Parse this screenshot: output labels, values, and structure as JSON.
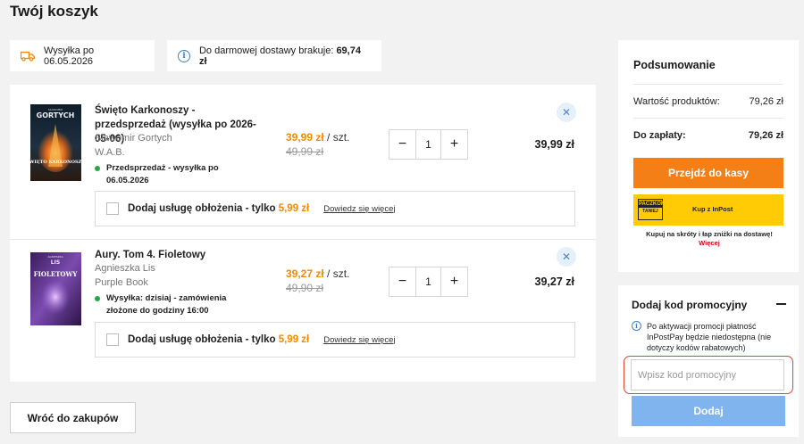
{
  "page": {
    "title": "Twój koszyk"
  },
  "shipping_pill": {
    "label": "Wysyłka po 06.05.2026",
    "icon": "truck-icon"
  },
  "free_delivery_pill": {
    "label": "Do darmowej dostawy brakuje:",
    "amount": "69,74 zł",
    "icon": "info-icon"
  },
  "items": [
    {
      "title": "Święto Karkonoszy - przedsprzedaż (wysyłka po 2026-05-06)",
      "author": "Sławomir Gortych",
      "publisher": "W.A.B.",
      "shipping": "Przedsprzedaż - wysyłka po 06.05.2026",
      "price": "39,99 zł",
      "unit": "/ szt.",
      "old_price": "49,99 zł",
      "quantity": "1",
      "total": "39,99 zł",
      "cover_author": "GORTYCH",
      "cover_author_small": "SŁAWOMIR",
      "cover_title": "ŚWIĘTO KARKONOSZY",
      "service": {
        "label": "Dodaj usługę obłożenia - ",
        "only": "tylko",
        "price": "5,99 zł",
        "more": "Dowiedz się więcej"
      }
    },
    {
      "title": "Aury. Tom 4. Fioletowy",
      "author": "Agnieszka Lis",
      "publisher": "Purple Book",
      "shipping": "Wysyłka: dzisiaj - zamówienia złożone do godziny 16:00",
      "price": "39,27 zł",
      "unit": "/ szt.",
      "old_price": "49,90 zł",
      "quantity": "1",
      "total": "39,27 zł",
      "cover_author": "LIS",
      "cover_author_small": "AGNIESZKA",
      "cover_title": "FIOLETOWY",
      "service": {
        "label": "Dodaj usługę obłożenia - ",
        "only": "tylko",
        "price": "5,99 zł",
        "more": "Dowiedz się więcej"
      }
    }
  ],
  "back_button": "Wróć do zakupów",
  "summary": {
    "title": "Podsumowanie",
    "products_label": "Wartość produktów:",
    "products_value": "79,26 zł",
    "to_pay_label": "Do zapłaty:",
    "to_pay_value": "79,26 zł",
    "checkout_button": "Przejdź do kasy",
    "inpost_logo_top": "PACZKOMAT",
    "inpost_logo_bottom": "TANIEJ",
    "inpost_text": "Kup z InPost",
    "inpost_note": "Kupuj na skróty i łap zniżki na dostawę!",
    "inpost_more": "Więcej"
  },
  "promo": {
    "title": "Dodaj kod promocyjny",
    "note": "Po aktywacji promocji płatność InPostPay będzie niedostępna (nie dotyczy kodów rabatowych)",
    "placeholder": "Wpisz kod promocyjny",
    "apply_button": "Dodaj"
  },
  "colors": {
    "accent": "#f57f17",
    "price": "#f08a00",
    "apply": "#7fb4ef",
    "highlight": "#e0442f",
    "inpost": "#ffcb05"
  }
}
